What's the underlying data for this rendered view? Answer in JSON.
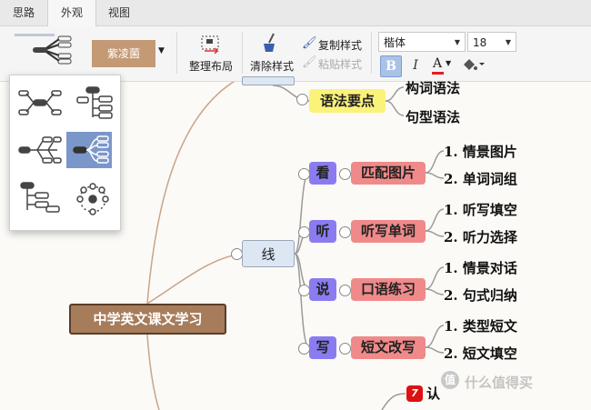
{
  "tabs": [
    {
      "label": "思路",
      "active": false
    },
    {
      "label": "外观",
      "active": true
    },
    {
      "label": "视图",
      "active": false
    }
  ],
  "toolbar": {
    "theme_label": "紫凌菌",
    "theme_color": "#c49a75",
    "arrange_label": "整理布局",
    "clear_style_label": "清除样式",
    "copy_style_label": "复制样式",
    "paste_style_label": "粘贴样式",
    "font_name": "楷体",
    "font_size": "18",
    "bold": "B",
    "italic": "I",
    "font_color": "A",
    "font_color_value": "#e02020"
  },
  "mindmap": {
    "root": "中学英文课文学习",
    "branch": "线",
    "top_node": "语法要点",
    "top_leaves": [
      "构词语法",
      "句型语法"
    ],
    "groups": [
      {
        "tag": "看",
        "topic": "匹配图片",
        "leaves": [
          "1. 情景图片",
          "2. 单词词组"
        ]
      },
      {
        "tag": "听",
        "topic": "听写单词",
        "leaves": [
          "1. 听写填空",
          "2. 听力选择"
        ]
      },
      {
        "tag": "说",
        "topic": "口语练习",
        "leaves": [
          "1. 情景对话",
          "2. 句式归纳"
        ]
      },
      {
        "tag": "写",
        "topic": "短文改写",
        "leaves": [
          "1. 类型短文",
          "2. 短文填空"
        ]
      }
    ],
    "bottom_badge": "7",
    "bottom_text": "认"
  },
  "colors": {
    "root_bg": "#a67c5b",
    "root_border": "#5a3d28",
    "tag_bg": "#8a7cf0",
    "topic_bg": "#f08a8a",
    "top_node_bg": "#fbf27a",
    "branch_bg": "#dde7f4",
    "line": "#c9a48a"
  },
  "layout_panel": {
    "options": [
      "tree-both-layout",
      "org-chart-layout",
      "fishbone-layout",
      "right-map-layout",
      "tree-left-layout",
      "radial-layout"
    ],
    "selected": "right-map-layout"
  },
  "watermark": "值 什么值得买"
}
